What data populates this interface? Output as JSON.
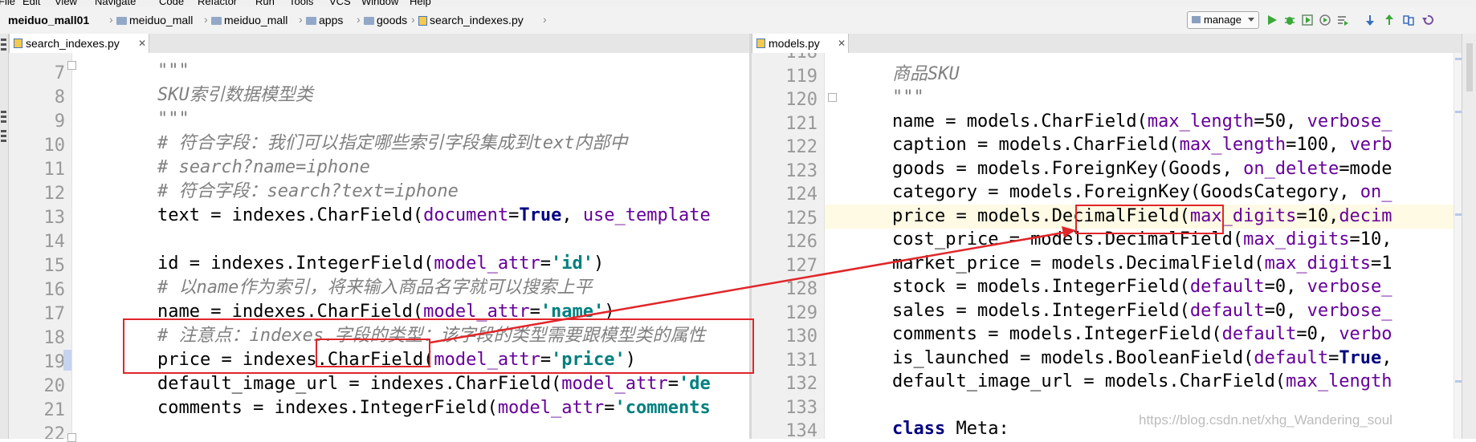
{
  "menu": [
    "File",
    "Edit",
    "View",
    "Navigate",
    "Code",
    "Refactor",
    "Run",
    "Tools",
    "VCS",
    "Window",
    "Help"
  ],
  "breadcrumb": {
    "project": "meiduo_mall01",
    "path": [
      "meiduo_mall",
      "meiduo_mall",
      "apps",
      "goods"
    ],
    "file": "search_indexes.py"
  },
  "run_config": "manage",
  "toolbar_icons": [
    "run-icon",
    "debug-icon",
    "coverage-icon",
    "profile-icon",
    "run-list-icon",
    "vcs-update-icon",
    "vcs-commit-icon",
    "vcs-compare-icon",
    "vcs-revert-icon"
  ],
  "left_editor": {
    "tab": "search_indexes.py",
    "lines": [
      {
        "n": "7",
        "t": "        \"\"\"",
        "k": "c"
      },
      {
        "n": "8",
        "t": "        SKU索引数据模型类",
        "k": "c"
      },
      {
        "n": "9",
        "t": "        \"\"\"",
        "k": "c"
      },
      {
        "n": "10",
        "t": "        # 符合字段：我们可以指定哪些索引字段集成到text内部中",
        "k": "c"
      },
      {
        "n": "11",
        "t": "        # search?name=iphone",
        "k": "c"
      },
      {
        "n": "12",
        "t": "        # 符合字段：search?text=iphone",
        "k": "c"
      },
      {
        "n": "13",
        "t": "",
        "k": "text"
      },
      {
        "n": "14",
        "t": "",
        "k": "plain"
      },
      {
        "n": "15",
        "t": "",
        "k": "id"
      },
      {
        "n": "16",
        "t": "        # 以name作为索引，将来输入商品名字就可以搜索上平",
        "k": "c"
      },
      {
        "n": "17",
        "t": "",
        "k": "name"
      },
      {
        "n": "18",
        "t": "        # 注意点：indexes.字段的类型：该字段的类型需要跟模型类的属性",
        "k": "c"
      },
      {
        "n": "19",
        "t": "",
        "k": "price"
      },
      {
        "n": "20",
        "t": "",
        "k": "img"
      },
      {
        "n": "21",
        "t": "",
        "k": "comments"
      },
      {
        "n": "22",
        "t": "",
        "k": "plain"
      }
    ],
    "code": {
      "text": [
        "text = indexes.CharField(",
        "document",
        "=",
        "True",
        ", ",
        "use_template"
      ],
      "id": [
        "id = indexes.IntegerField(",
        "model_attr",
        "=",
        "'id'",
        ")"
      ],
      "name": [
        "name = indexes.CharField(",
        "model_attr",
        "=",
        "'name'",
        ")"
      ],
      "price": [
        "price = indexes.",
        "CharField",
        "(",
        "model_attr",
        "=",
        "'price'",
        ")"
      ],
      "img": [
        "default_image_url = indexes.CharField(",
        "model_attr",
        "=",
        "'de"
      ],
      "comments": [
        "comments = indexes.IntegerField(",
        "model_attr",
        "=",
        "'comments"
      ]
    }
  },
  "right_editor": {
    "tab": "models.py",
    "lines": [
      {
        "n": "118",
        "t": ""
      },
      {
        "n": "119",
        "t": "商品SKU"
      },
      {
        "n": "120",
        "t": "\"\"\""
      },
      {
        "n": "121",
        "t": "name = models.CharField(max_length=50, verbose_"
      },
      {
        "n": "122",
        "t": "caption = models.CharField(max_length=100, verb"
      },
      {
        "n": "123",
        "t": "goods = models.ForeignKey(Goods, on_delete=mode"
      },
      {
        "n": "124",
        "t": "category = models.ForeignKey(GoodsCategory, on_"
      },
      {
        "n": "125",
        "t": "price = models.DecimalField(max_digits=10,decim"
      },
      {
        "n": "126",
        "t": "cost_price = models.DecimalField(max_digits=10,"
      },
      {
        "n": "127",
        "t": "market_price = models.DecimalField(max_digits=1"
      },
      {
        "n": "128",
        "t": "stock = models.IntegerField(default=0, verbose_"
      },
      {
        "n": "129",
        "t": "sales = models.IntegerField(default=0, verbose_"
      },
      {
        "n": "130",
        "t": "comments = models.IntegerField(default=0, verbo"
      },
      {
        "n": "131",
        "t": "is_launched = models.BooleanField(default=True,"
      },
      {
        "n": "132",
        "t": "default_image_url = models.CharField(max_length"
      },
      {
        "n": "133",
        "t": ""
      },
      {
        "n": "134",
        "t": "class Meta:"
      }
    ]
  },
  "watermark": "https://blog.csdn.net/xhg_Wandering_soul"
}
